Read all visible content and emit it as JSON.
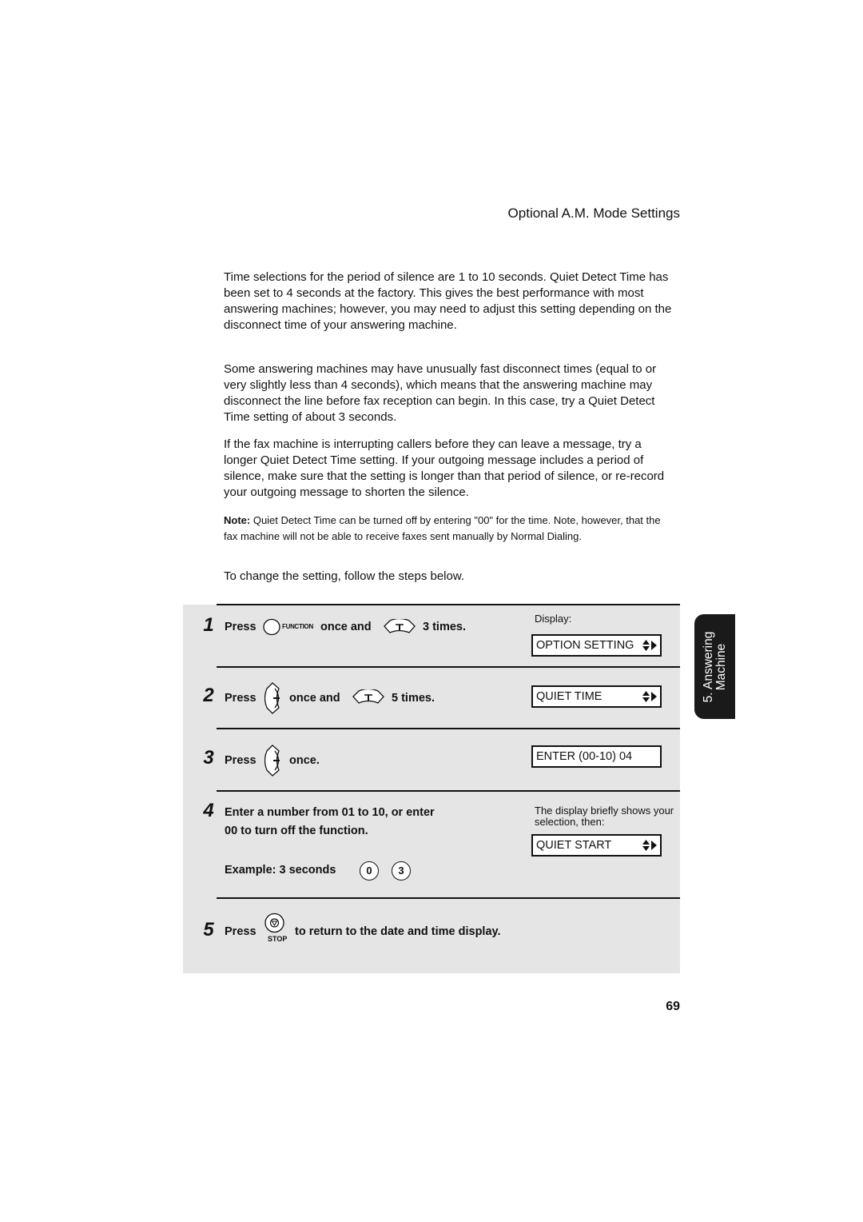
{
  "header": {
    "title": "Optional A.M. Mode Settings"
  },
  "paragraphs": [
    "Time selections for the period of silence are 1 to 10 seconds. Quiet Detect Time has been set to 4 seconds at the factory. This gives the best performance with most answering machines; however, you may need to adjust this setting depending on the disconnect time of your answering machine.",
    "Some answering machines may have unusually fast disconnect times (equal to or very slightly less than 4 seconds), which means that the answering machine may disconnect the line before fax reception can begin. In this case, try a Quiet Detect Time setting of about 3 seconds.",
    "If the fax machine is interrupting callers before they can leave a message, try a longer Quiet Detect Time setting. If your outgoing message includes a period of silence, make sure that the setting is longer than that period of silence, or re-record your outgoing message to shorten the silence."
  ],
  "note": {
    "label": "Note:",
    "text": " Quiet Detect Time can be turned off by entering \"00\" for the time. Note, however, that the fax machine will not be able to receive faxes sent manually by Normal Dialing."
  },
  "intro": "To change the setting, follow the steps below.",
  "steps": [
    {
      "number": "1",
      "press": "Press",
      "function_label": "FUNCTION",
      "once_and": "once and",
      "times": "3 times."
    },
    {
      "number": "2",
      "press": "Press",
      "once_and": "once and",
      "times": "5 times."
    },
    {
      "number": "3",
      "press": "Press",
      "once": "once."
    },
    {
      "number": "4",
      "line1": "Enter a number from 01 to 10, or enter",
      "line2": "00 to turn off the function.",
      "example": "Example: 3 seconds",
      "keys": [
        "0",
        "3"
      ]
    },
    {
      "number": "5",
      "press": "Press",
      "stop_label": "STOP",
      "rest": "to return to the date and time display."
    }
  ],
  "display": {
    "label": "Display:",
    "screens": [
      "OPTION SETTING",
      "QUIET TIME",
      "ENTER (00-10) 04",
      "QUIET START"
    ],
    "note": "The display briefly shows your selection, then:"
  },
  "side_tab": {
    "line1": "5. Answering",
    "line2": "Machine"
  },
  "page_number": "69"
}
